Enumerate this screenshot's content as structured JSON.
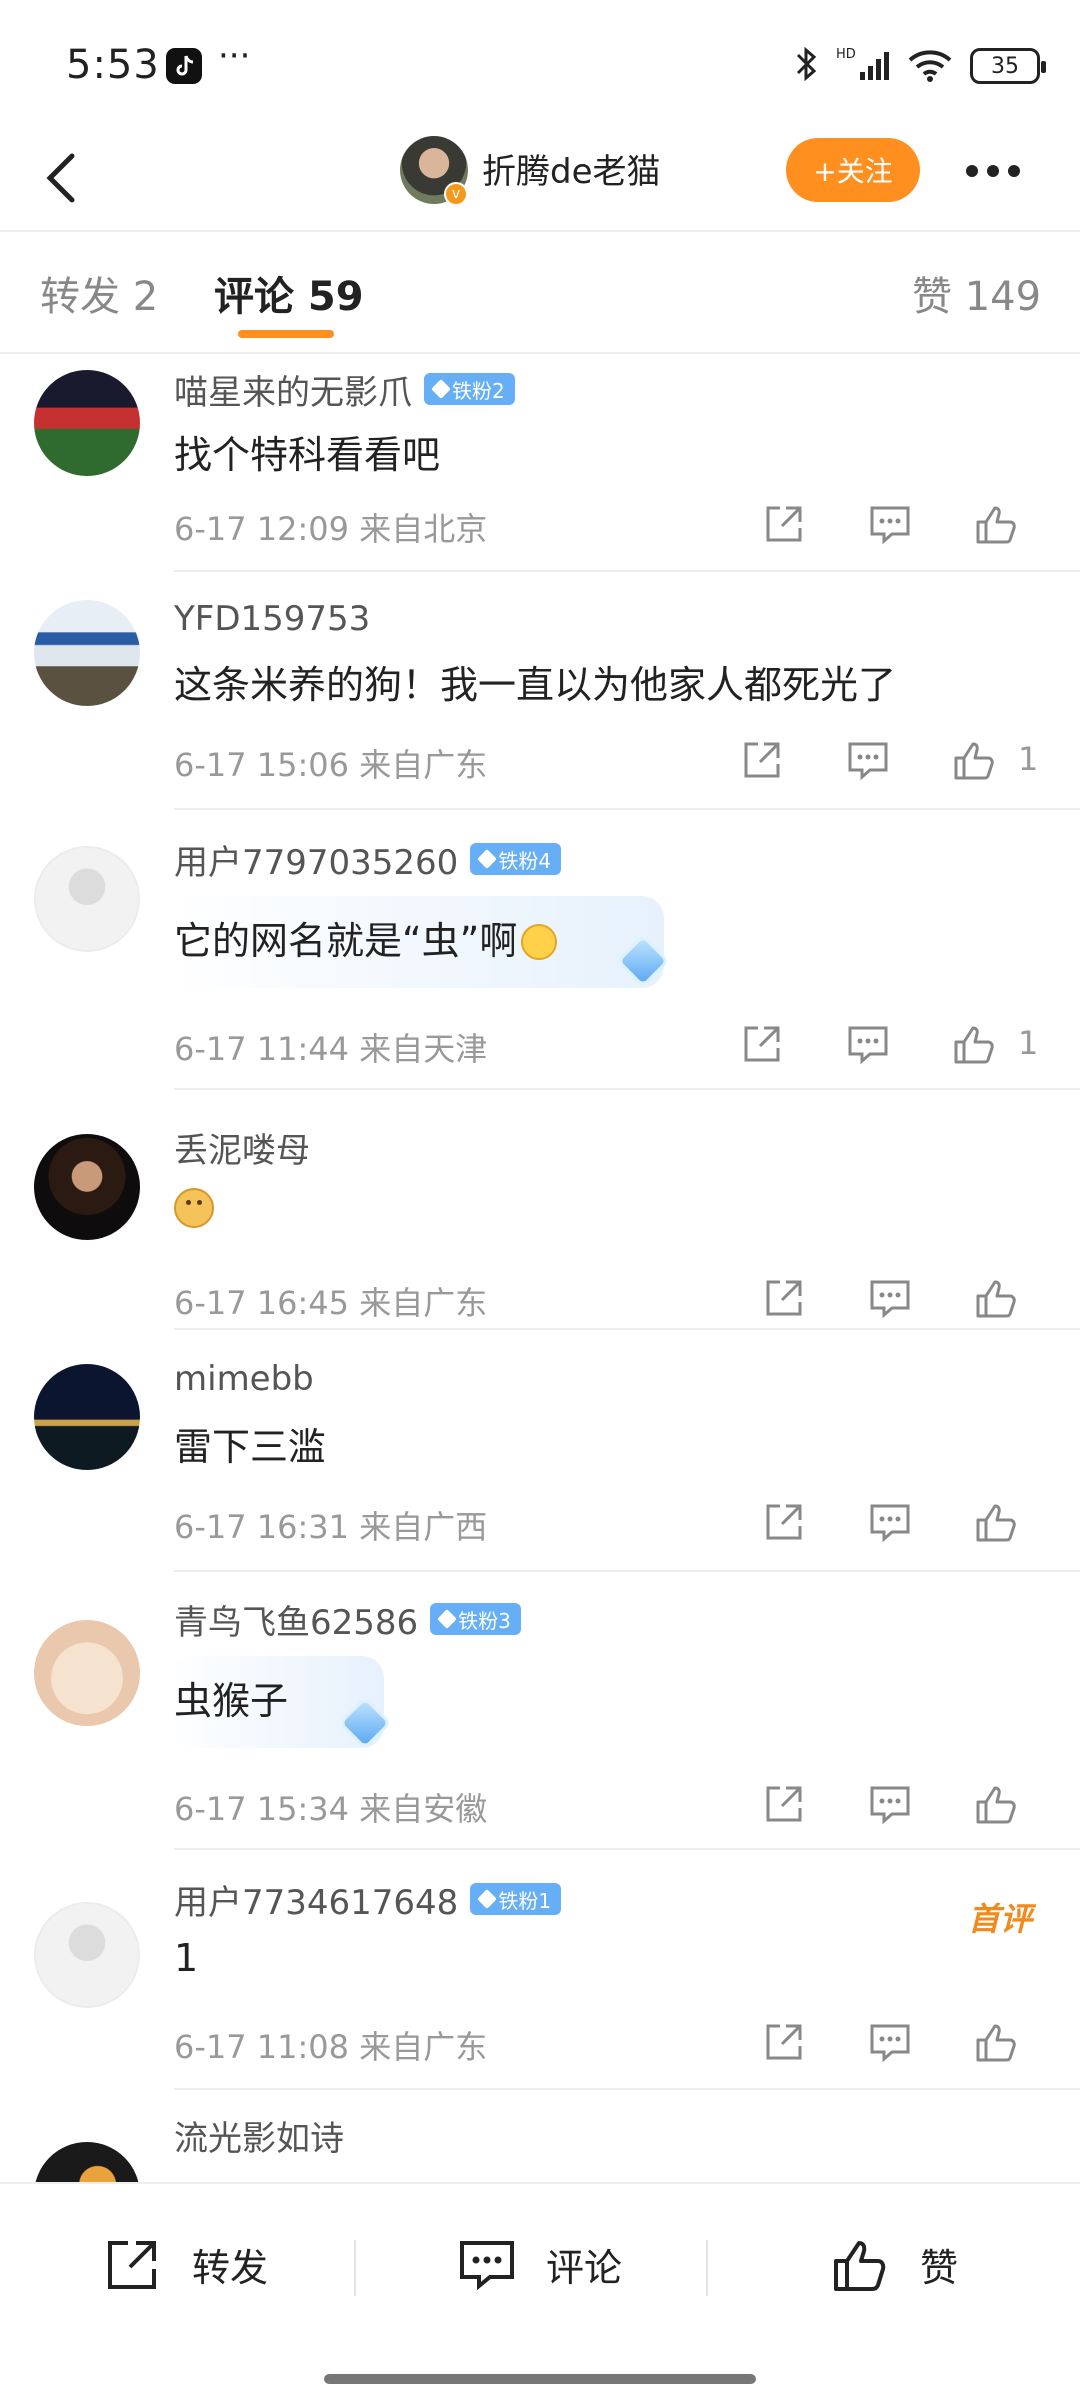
{
  "status_bar": {
    "time": "5:53",
    "more": "···",
    "battery": "35"
  },
  "header": {
    "author_name": "折腾de老猫",
    "follow_label": "+关注"
  },
  "tabs": [
    {
      "label": "转发 2"
    },
    {
      "label": "评论 59"
    },
    {
      "label": "赞 149"
    }
  ],
  "comments": [
    {
      "user": "喵星来的无影爪",
      "badge": "铁粉2",
      "text": "找个特科看看吧",
      "meta": "6-17 12:09  来自北京",
      "likes": ""
    },
    {
      "user": "YFD159753",
      "badge": "",
      "text": "这条米养的狗！我一直以为他家人都死光了",
      "meta": "6-17 15:06  来自广东",
      "likes": "1"
    },
    {
      "user": "用户7797035260",
      "badge": "铁粉4",
      "text": "它的网名就是“虫”啊",
      "meta": "6-17 11:44  来自天津",
      "likes": "1"
    },
    {
      "user": "丢泥喽母",
      "badge": "",
      "text": "",
      "meta": "6-17 16:45  来自广东",
      "likes": ""
    },
    {
      "user": "mimebb",
      "badge": "",
      "text": "雷下三滥",
      "meta": "6-17 16:31  来自广西",
      "likes": ""
    },
    {
      "user": "青鸟飞鱼62586",
      "badge": "铁粉3",
      "text": "虫猴子",
      "meta": "6-17 15:34  来自安徽",
      "likes": ""
    },
    {
      "user": "用户7734617648",
      "badge": "铁粉1",
      "text": "1",
      "meta": "6-17 11:08  来自广东",
      "likes": "",
      "tag": "首评"
    },
    {
      "user": "流光影如诗",
      "badge": "",
      "text": "",
      "meta": "",
      "likes": ""
    }
  ],
  "bottom_bar": {
    "repost": "转发",
    "comment": "评论",
    "like": "赞"
  },
  "colors": {
    "accent": "#ff8f1f",
    "fan_badge": "#66aef5",
    "meta_text": "#999999"
  }
}
